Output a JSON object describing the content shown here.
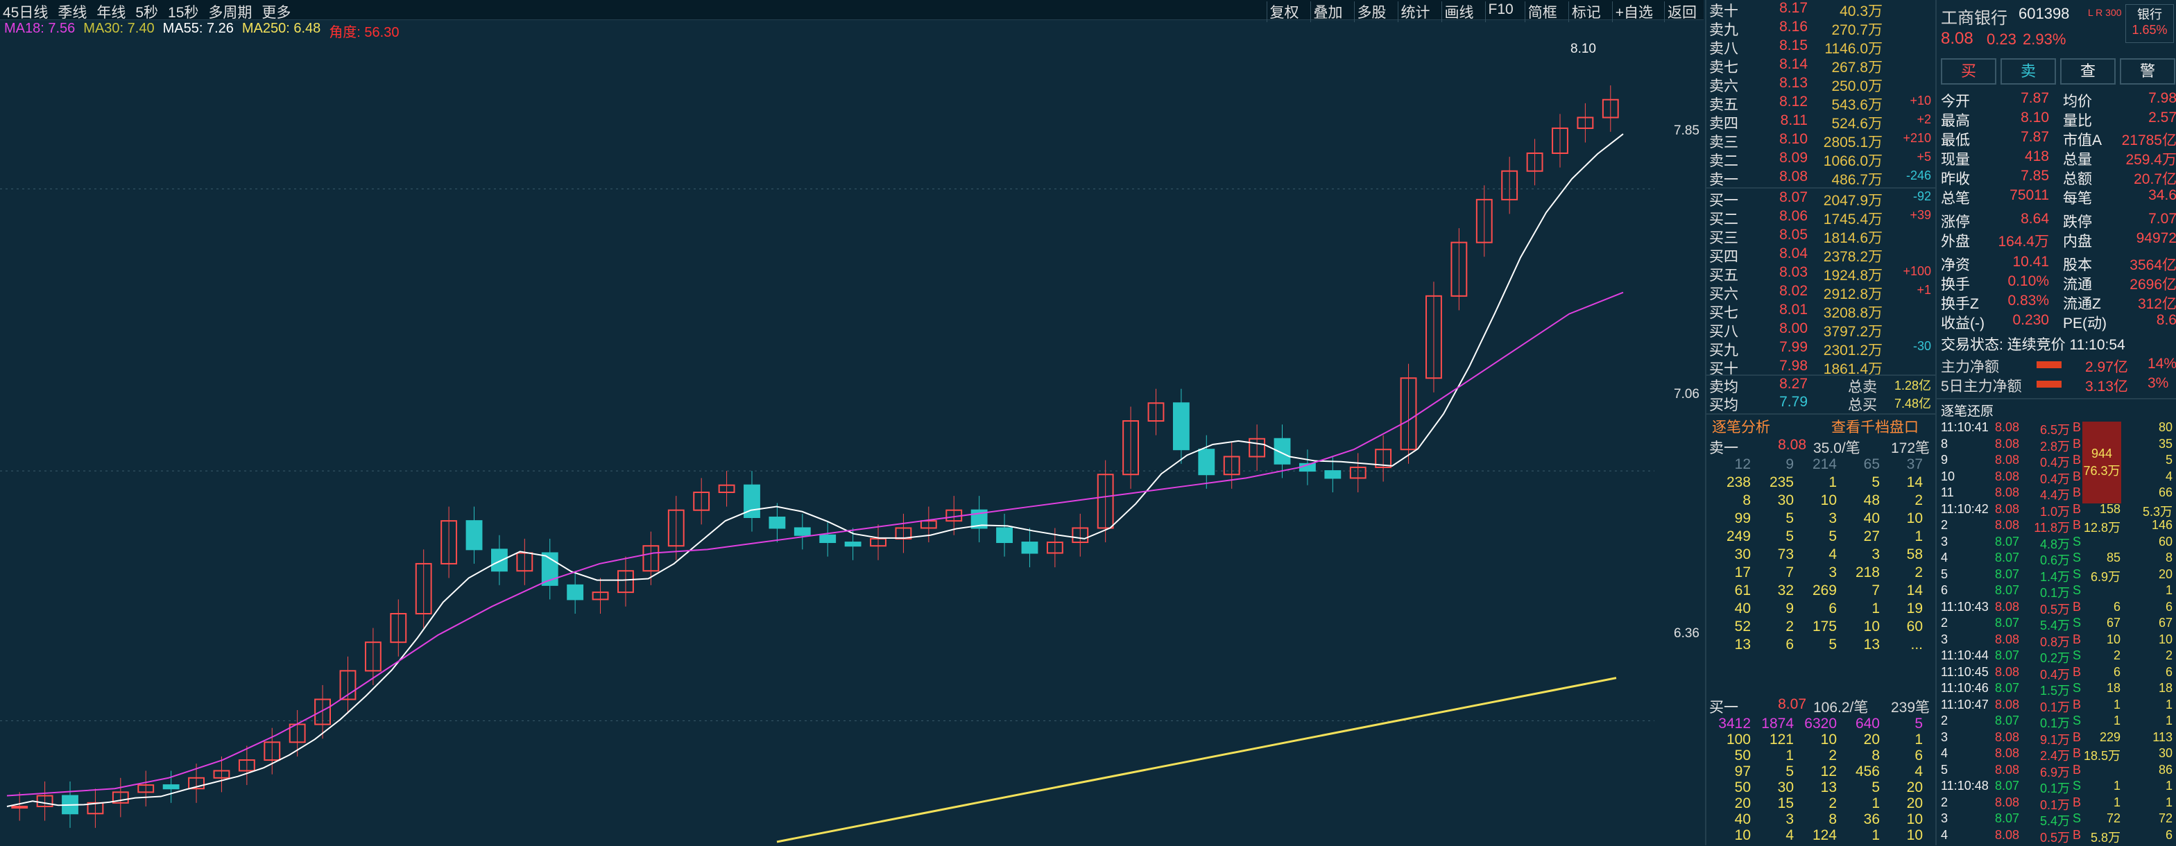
{
  "toolbar": {
    "left_items": [
      "45日线",
      "季线",
      "年线",
      "5秒",
      "15秒",
      "多周期",
      "更多"
    ],
    "right_items": [
      "复权",
      "叠加",
      "多股",
      "统计",
      "画线",
      "F10",
      "简框",
      "标记",
      "+自选",
      "返回"
    ]
  },
  "ma_bar": [
    {
      "label": "MA18: 7.56",
      "color": "#e040e0"
    },
    {
      "label": "MA30: 7.40",
      "color": "#c9c23b"
    },
    {
      "label": "MA55: 7.26",
      "color": "#ffffff"
    },
    {
      "label": "MA250: 6.48",
      "color": "#f3e15a"
    },
    {
      "label": "角度: 56.30",
      "color": "#ff3030"
    }
  ],
  "price_axis": [
    "7.85",
    "7.06",
    "6.36"
  ],
  "high_marker": "8.10",
  "chart_data": {
    "type": "candlestick",
    "note_values": "approximate closing prices read from chart",
    "closes": [
      6.12,
      6.15,
      6.1,
      6.13,
      6.16,
      6.18,
      6.17,
      6.2,
      6.22,
      6.25,
      6.3,
      6.35,
      6.42,
      6.5,
      6.58,
      6.66,
      6.8,
      6.92,
      6.84,
      6.78,
      6.83,
      6.74,
      6.7,
      6.72,
      6.78,
      6.85,
      6.95,
      7.0,
      7.02,
      6.93,
      6.9,
      6.88,
      6.86,
      6.85,
      6.87,
      6.9,
      6.92,
      6.95,
      6.9,
      6.86,
      6.83,
      6.86,
      6.9,
      7.05,
      7.2,
      7.25,
      7.12,
      7.05,
      7.1,
      7.15,
      7.08,
      7.06,
      7.04,
      7.07,
      7.12,
      7.32,
      7.55,
      7.7,
      7.82,
      7.9,
      7.95,
      8.02,
      8.05,
      8.1
    ],
    "ma18": [
      6.15,
      6.16,
      6.17,
      6.2,
      6.25,
      6.32,
      6.4,
      6.5,
      6.6,
      6.68,
      6.75,
      6.8,
      6.83,
      6.84,
      6.86,
      6.88,
      6.9,
      6.92,
      6.94,
      6.96,
      6.98,
      7.0,
      7.02,
      7.04,
      7.07,
      7.12,
      7.2,
      7.3,
      7.4,
      7.5,
      7.56
    ],
    "ma250_start": 6.05,
    "ma250_end": 6.48,
    "price_min": 6.05,
    "price_max": 8.15
  },
  "order_book": {
    "asks": [
      {
        "level": "卖十",
        "price": "8.17",
        "vol": "40.3万",
        "chg": ""
      },
      {
        "level": "卖九",
        "price": "8.16",
        "vol": "270.7万",
        "chg": ""
      },
      {
        "level": "卖八",
        "price": "8.15",
        "vol": "1146.0万",
        "chg": ""
      },
      {
        "level": "卖七",
        "price": "8.14",
        "vol": "267.8万",
        "chg": ""
      },
      {
        "level": "卖六",
        "price": "8.13",
        "vol": "250.0万",
        "chg": ""
      },
      {
        "level": "卖五",
        "price": "8.12",
        "vol": "543.6万",
        "chg": "+10"
      },
      {
        "level": "卖四",
        "price": "8.11",
        "vol": "524.6万",
        "chg": "+2"
      },
      {
        "level": "卖三",
        "price": "8.10",
        "vol": "2805.1万",
        "chg": "+210"
      },
      {
        "level": "卖二",
        "price": "8.09",
        "vol": "1066.0万",
        "chg": "+5"
      },
      {
        "level": "卖一",
        "price": "8.08",
        "vol": "486.7万",
        "chg": "-246"
      }
    ],
    "bids": [
      {
        "level": "买一",
        "price": "8.07",
        "vol": "2047.9万",
        "chg": "-92"
      },
      {
        "level": "买二",
        "price": "8.06",
        "vol": "1745.4万",
        "chg": "+39"
      },
      {
        "level": "买三",
        "price": "8.05",
        "vol": "1814.6万",
        "chg": ""
      },
      {
        "level": "买四",
        "price": "8.04",
        "vol": "2378.2万",
        "chg": ""
      },
      {
        "level": "买五",
        "price": "8.03",
        "vol": "1924.8万",
        "chg": "+100"
      },
      {
        "level": "买六",
        "price": "8.02",
        "vol": "2912.8万",
        "chg": "+1"
      },
      {
        "level": "买七",
        "price": "8.01",
        "vol": "3208.8万",
        "chg": ""
      },
      {
        "level": "买八",
        "price": "8.00",
        "vol": "3797.2万",
        "chg": ""
      },
      {
        "level": "买九",
        "price": "7.99",
        "vol": "2301.2万",
        "chg": "-30"
      },
      {
        "level": "买十",
        "price": "7.98",
        "vol": "1861.4万",
        "chg": ""
      }
    ],
    "avg_sell_label": "卖均",
    "avg_sell": "8.27",
    "total_sell_label": "总卖",
    "total_sell": "1.28亿",
    "avg_buy_label": "买均",
    "avg_buy": "7.79",
    "total_buy_label": "总买",
    "total_buy": "7.48亿",
    "tab_tick": "逐笔分析",
    "tab_deep": "查看千档盘口",
    "sell1_header": {
      "label": "卖一",
      "price": "8.08",
      "per": "35.0/笔",
      "count": "172笔"
    },
    "sell_queue": [
      [
        "12",
        "9",
        "214",
        "65",
        "37"
      ],
      [
        "238",
        "235",
        "1",
        "5",
        "14"
      ],
      [
        "8",
        "30",
        "10",
        "48",
        "2"
      ],
      [
        "99",
        "5",
        "3",
        "40",
        "10"
      ],
      [
        "249",
        "5",
        "5",
        "27",
        "1"
      ],
      [
        "30",
        "73",
        "4",
        "3",
        "58"
      ],
      [
        "17",
        "7",
        "3",
        "218",
        "2"
      ],
      [
        "61",
        "32",
        "269",
        "7",
        "14"
      ],
      [
        "40",
        "9",
        "6",
        "1",
        "19"
      ],
      [
        "52",
        "2",
        "175",
        "10",
        "60"
      ],
      [
        "13",
        "6",
        "5",
        "13",
        "..."
      ]
    ],
    "buy1_header": {
      "label": "买一",
      "price": "8.07",
      "per": "106.2/笔",
      "count": "239笔"
    },
    "buy_queue": [
      [
        "3412",
        "1874",
        "6320",
        "640",
        "5"
      ],
      [
        "100",
        "121",
        "10",
        "20",
        "1"
      ],
      [
        "50",
        "1",
        "2",
        "8",
        "6"
      ],
      [
        "97",
        "5",
        "12",
        "456",
        "4"
      ],
      [
        "50",
        "30",
        "13",
        "5",
        "20"
      ],
      [
        "20",
        "15",
        "2",
        "1",
        "20"
      ],
      [
        "40",
        "3",
        "8",
        "36",
        "10"
      ],
      [
        "10",
        "4",
        "124",
        "1",
        "10"
      ]
    ]
  },
  "stock": {
    "name": "工商银行",
    "code": "601398",
    "tag": "L R 300",
    "sector": "银行",
    "sector_chg": "1.65%",
    "price": "8.08",
    "change": "0.23",
    "change_pct": "2.93%",
    "btn_buy": "买",
    "btn_sell": "卖",
    "btn_query": "查",
    "btn_alert": "警"
  },
  "quote": [
    {
      "k": "今开",
      "v": "7.87",
      "k2": "均价",
      "v2": "7.98"
    },
    {
      "k": "最高",
      "v": "8.10",
      "k2": "量比",
      "v2": "2.57"
    },
    {
      "k": "最低",
      "v": "7.87",
      "k2": "市值A",
      "v2": "21785亿"
    },
    {
      "k": "现量",
      "v": "418",
      "k2": "总量",
      "v2": "259.4万"
    },
    {
      "k": "昨收",
      "v": "7.85",
      "k2": "总额",
      "v2": "20.7亿"
    },
    {
      "k": "总笔",
      "v": "75011",
      "k2": "每笔",
      "v2": "34.6"
    },
    {
      "k": "涨停",
      "v": "8.64",
      "k2": "跌停",
      "v2": "7.07"
    },
    {
      "k": "外盘",
      "v": "164.4万",
      "k2": "内盘",
      "v2": "94972"
    },
    {
      "k": "净资",
      "v": "10.41",
      "k2": "股本",
      "v2": "3564亿"
    },
    {
      "k": "换手",
      "v": "0.10%",
      "k2": "流通",
      "v2": "2696亿"
    },
    {
      "k": "换手Z",
      "v": "0.83%",
      "k2": "流通Z",
      "v2": "312亿"
    },
    {
      "k": "收益(-)",
      "v": "0.230",
      "k2": "PE(动)",
      "v2": "8.6"
    }
  ],
  "trade_status": "交易状态: 连续竞价 11:10:54",
  "main_flow": {
    "label": "主力净额",
    "value": "2.97亿",
    "pct": "14%"
  },
  "main_flow5": {
    "label": "5日主力净额",
    "value": "3.13亿",
    "pct": "3%"
  },
  "tick_title": "逐笔还原",
  "ticks": [
    {
      "t": "11:10:41",
      "p": "8.08",
      "v": "6.5万",
      "s": "B",
      "a": "",
      "b": "80"
    },
    {
      "t": "8",
      "p": "8.08",
      "v": "2.8万",
      "s": "B",
      "a": "",
      "b": "35"
    },
    {
      "t": "9",
      "p": "8.08",
      "v": "0.4万",
      "s": "B",
      "a": "",
      "b": "5"
    },
    {
      "t": "10",
      "p": "8.08",
      "v": "0.4万",
      "s": "B",
      "a": "",
      "b": "4"
    },
    {
      "t": "11",
      "p": "8.08",
      "v": "4.4万",
      "s": "B",
      "a": "",
      "b": "66"
    },
    {
      "t": "11:10:42",
      "p": "8.08",
      "v": "1.0万",
      "s": "B",
      "a": "158",
      "b": "5.3万"
    },
    {
      "t": "2",
      "p": "8.08",
      "v": "11.8万",
      "s": "B",
      "a": "12.8万",
      "b": "146"
    },
    {
      "t": "3",
      "p": "8.07",
      "v": "4.8万",
      "s": "S",
      "a": "",
      "b": "60"
    },
    {
      "t": "4",
      "p": "8.07",
      "v": "0.6万",
      "s": "S",
      "a": "85",
      "b": "8"
    },
    {
      "t": "5",
      "p": "8.07",
      "v": "1.4万",
      "s": "S",
      "a": "6.9万",
      "b": "20"
    },
    {
      "t": "6",
      "p": "8.07",
      "v": "0.1万",
      "s": "S",
      "a": "",
      "b": "1"
    },
    {
      "t": "11:10:43",
      "p": "8.08",
      "v": "0.5万",
      "s": "B",
      "a": "6",
      "b": "6"
    },
    {
      "t": "2",
      "p": "8.07",
      "v": "5.4万",
      "s": "S",
      "a": "67",
      "b": "67"
    },
    {
      "t": "3",
      "p": "8.08",
      "v": "0.8万",
      "s": "B",
      "a": "10",
      "b": "10"
    },
    {
      "t": "11:10:44",
      "p": "8.07",
      "v": "0.2万",
      "s": "S",
      "a": "2",
      "b": "2"
    },
    {
      "t": "11:10:45",
      "p": "8.08",
      "v": "0.4万",
      "s": "B",
      "a": "6",
      "b": "6"
    },
    {
      "t": "11:10:46",
      "p": "8.07",
      "v": "1.5万",
      "s": "S",
      "a": "18",
      "b": "18"
    },
    {
      "t": "11:10:47",
      "p": "8.08",
      "v": "0.1万",
      "s": "B",
      "a": "1",
      "b": "1"
    },
    {
      "t": "2",
      "p": "8.07",
      "v": "0.1万",
      "s": "S",
      "a": "1",
      "b": "1"
    },
    {
      "t": "3",
      "p": "8.08",
      "v": "9.1万",
      "s": "B",
      "a": "229",
      "b": "113"
    },
    {
      "t": "4",
      "p": "8.08",
      "v": "2.4万",
      "s": "B",
      "a": "18.5万",
      "b": "30"
    },
    {
      "t": "5",
      "p": "8.08",
      "v": "6.9万",
      "s": "B",
      "a": "",
      "b": "86"
    },
    {
      "t": "11:10:48",
      "p": "8.07",
      "v": "0.1万",
      "s": "S",
      "a": "1",
      "b": "1"
    },
    {
      "t": "2",
      "p": "8.08",
      "v": "0.1万",
      "s": "B",
      "a": "1",
      "b": "1"
    },
    {
      "t": "3",
      "p": "8.07",
      "v": "5.4万",
      "s": "S",
      "a": "72",
      "b": "72"
    },
    {
      "t": "4",
      "p": "8.08",
      "v": "0.5万",
      "s": "B",
      "a": "5.8万",
      "b": "6"
    }
  ],
  "big_block_1": {
    "vol": "944",
    "amt": "76.3万"
  },
  "colors": {
    "bg": "#0e2a3a",
    "up": "#ff4d4d",
    "down": "#1ecf5a",
    "vol": "#e8c34a"
  }
}
